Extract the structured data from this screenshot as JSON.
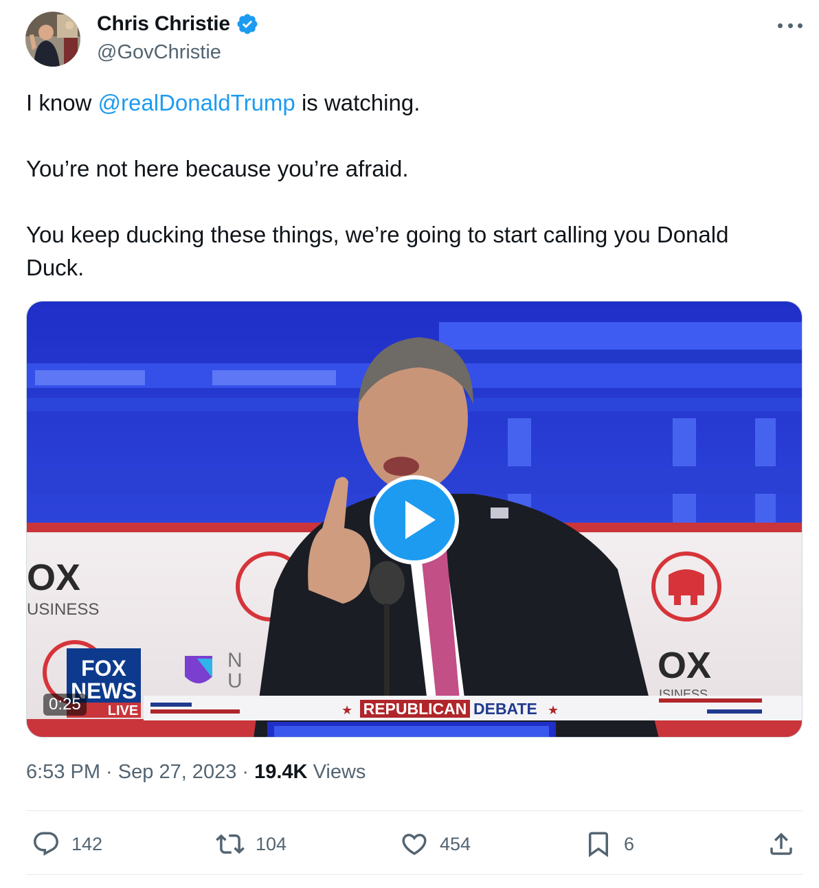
{
  "author": {
    "display_name": "Chris Christie",
    "handle": "@GovChristie",
    "verified": true
  },
  "tweet": {
    "line1_prefix": "I know ",
    "line1_mention": "@realDonaldTrump",
    "line1_suffix": " is watching.",
    "line2": "You’re not here because you’re afraid.",
    "line3": "You keep ducking these things, we’re going to start calling you Donald Duck."
  },
  "media": {
    "type": "video",
    "duration": "0:25",
    "overlay": {
      "banner_left": "REPUBLICAN",
      "banner_right": "DEBATE",
      "network_line1": "FOX",
      "network_line2": "NEWS",
      "network_line3": "LIVE",
      "backdrop_logo_left": "OX",
      "backdrop_sub_left": "USINESS",
      "backdrop_logo_right": "OX",
      "backdrop_sub_right": "ISINESS",
      "partner_fragment_1": "N",
      "partner_fragment_2": "U"
    }
  },
  "meta": {
    "time": "6:53 PM",
    "separator": " · ",
    "date": "Sep 27, 2023",
    "views_count": "19.4K",
    "views_label": "Views"
  },
  "actions": {
    "replies": "142",
    "reposts": "104",
    "likes": "454",
    "bookmarks": "6"
  },
  "icons": {
    "avatar": "avatar-image",
    "verified": "verified-badge-icon",
    "more": "more-icon",
    "reply": "reply-icon",
    "repost": "repost-icon",
    "like": "heart-icon",
    "bookmark": "bookmark-icon",
    "share": "share-icon",
    "play": "play-icon"
  },
  "colors": {
    "accent": "#1d9bf0",
    "text": "#0f1419",
    "secondary": "#536471",
    "banner_red": "#b0262b",
    "banner_blue": "#213a8f"
  }
}
